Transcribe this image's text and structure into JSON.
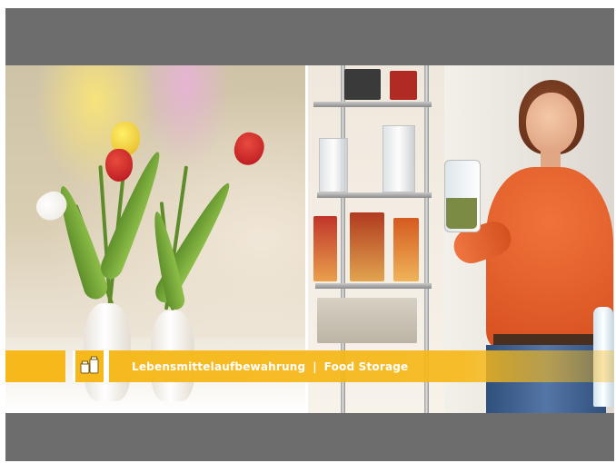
{
  "caption": {
    "german": "Lebensmittelaufbewahrung",
    "separator": "|",
    "english": "Food Storage"
  },
  "icons": {
    "lower_third_icon": "storage-containers-icon"
  },
  "colors": {
    "frame_gray": "#6d6d6d",
    "bar_yellow": "#f6b81a",
    "bar_text": "#ffffff"
  }
}
